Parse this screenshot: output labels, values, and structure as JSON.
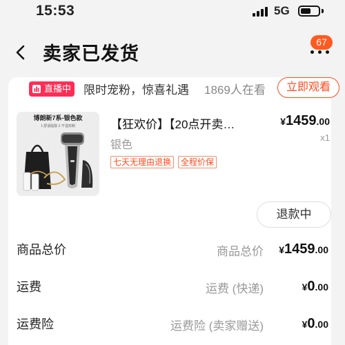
{
  "status_bar": {
    "time": "15:53",
    "network": "5G",
    "battery_level": 0.6
  },
  "header": {
    "title": "卖家已发货",
    "message_count": "67"
  },
  "live_banner": {
    "tag": "直播中",
    "promo_text": "限时宠粉，惊喜礼遇",
    "viewers": "1869人在看",
    "watch_label": "立即观看"
  },
  "product": {
    "image_brand": "博朗新7系-银色款",
    "image_note": "1.舒适贴肤  2.干湿双剃",
    "title": "【狂欢价】【20点开卖…",
    "spec": "银色",
    "tags": [
      "七天无理由退换",
      "全程价保"
    ],
    "price": {
      "currency": "¥",
      "integer": "1459",
      "decimal": ".00"
    },
    "quantity": "x1"
  },
  "refund_button": {
    "label": "退款中"
  },
  "summary": [
    {
      "label": "商品总价",
      "desc": "商品总价",
      "currency": "¥",
      "integer": "1459",
      "decimal": ".00"
    },
    {
      "label": "运费",
      "desc": "运费 (快递)",
      "currency": "¥",
      "integer": "0",
      "decimal": ".00"
    },
    {
      "label": "运费险",
      "desc": "运费险 (卖家赠送)",
      "currency": "¥",
      "integer": "0",
      "decimal": ".00"
    }
  ],
  "colors": {
    "accent": "#ff4a1f",
    "live": "#ff2d55",
    "badge": "#ff5a1f",
    "background": "#f3f3f3"
  }
}
